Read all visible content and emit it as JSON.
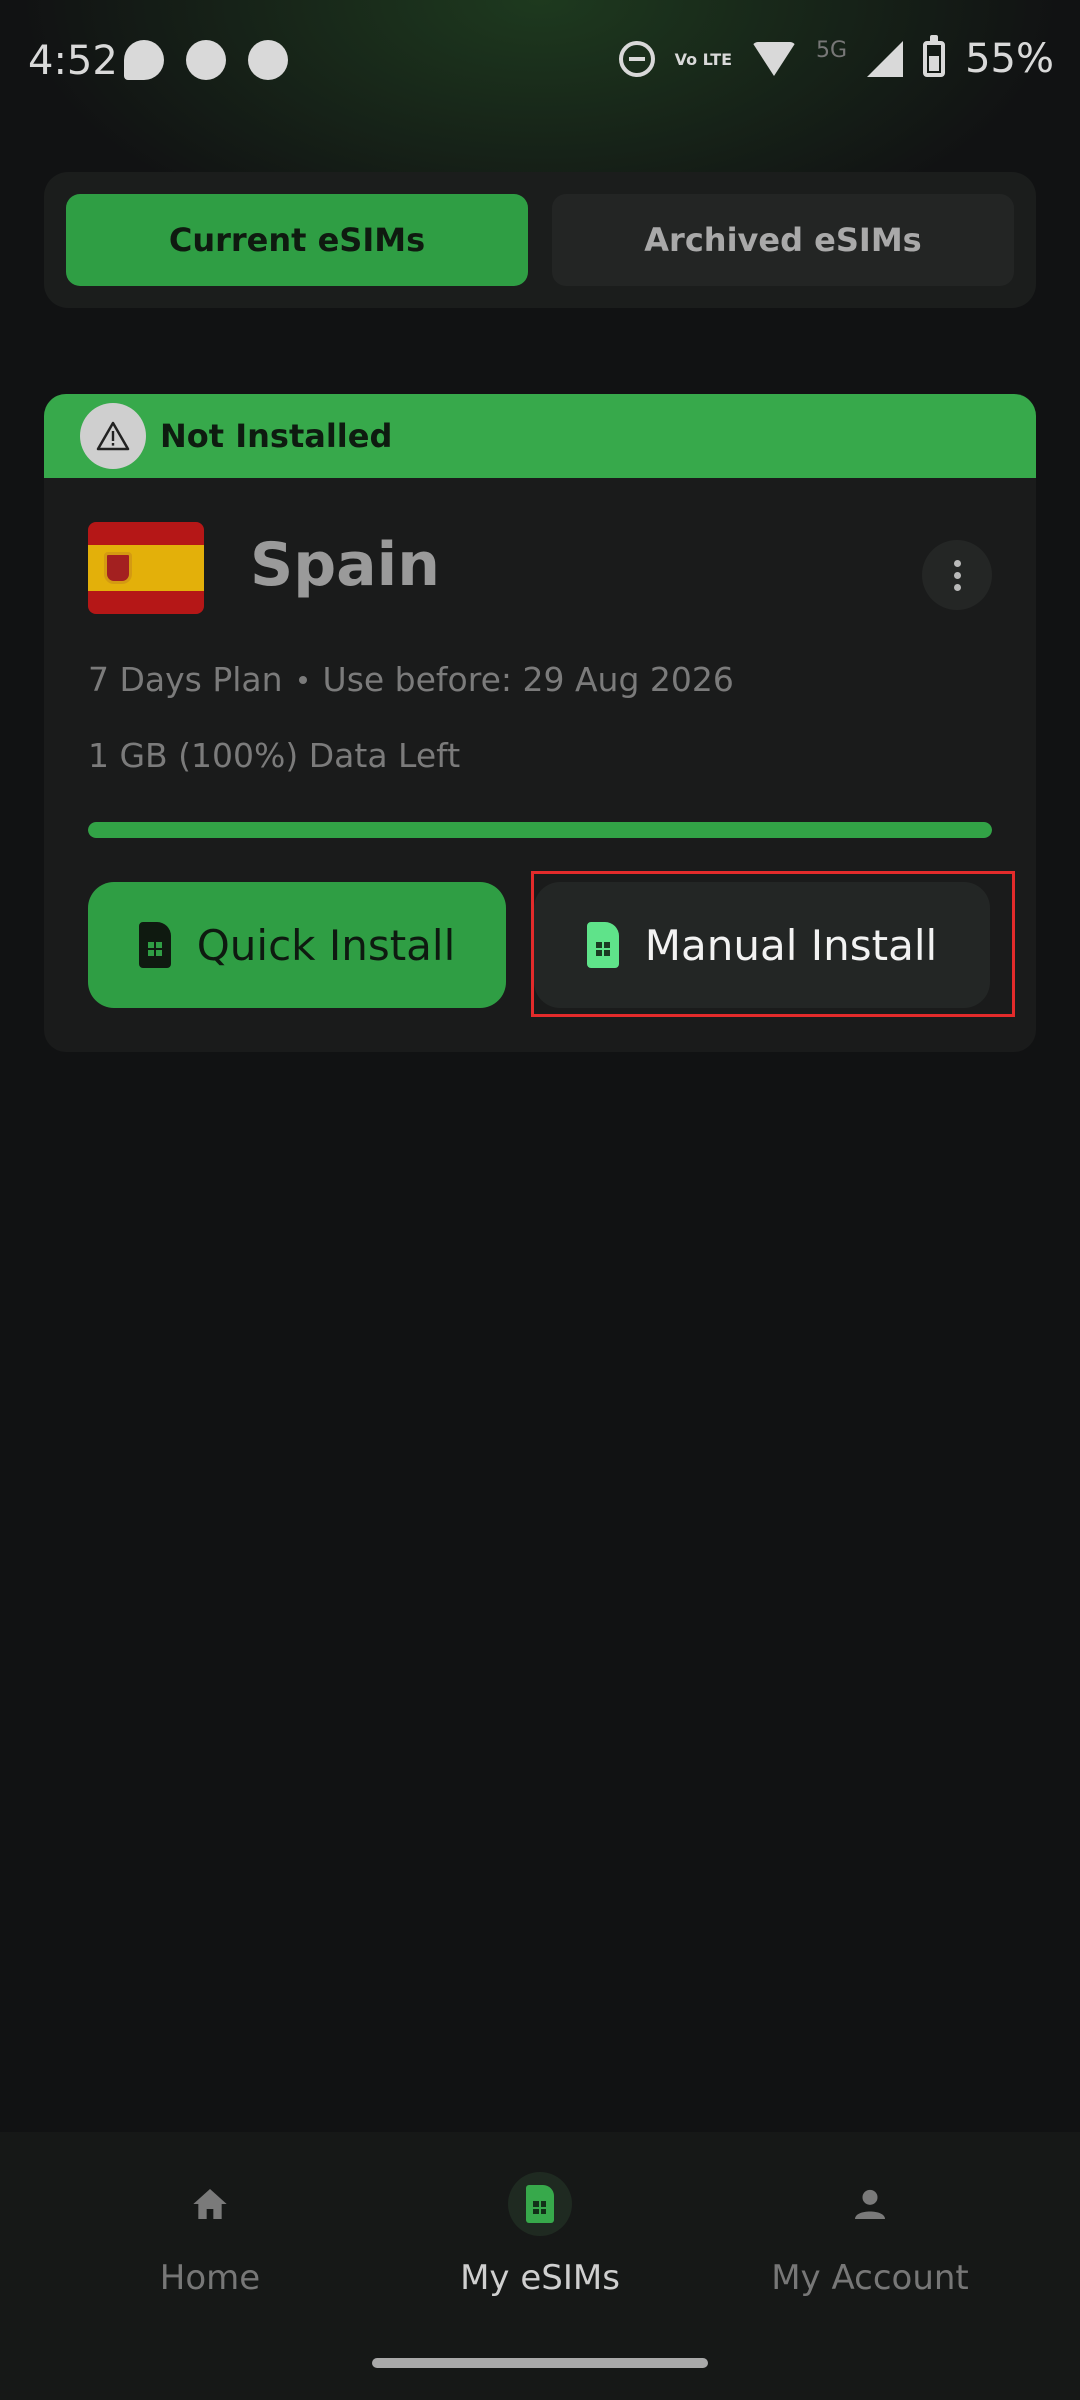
{
  "status_bar": {
    "time": "4:52",
    "network": "5G",
    "volte": "Vo LTE",
    "battery": "55%",
    "battery_level_pct": 55
  },
  "tabs": {
    "current": "Current eSIMs",
    "archived": "Archived eSIMs",
    "selected": "current"
  },
  "esim_card": {
    "status": "Not Installed",
    "country": "Spain",
    "plan": "7 Days Plan",
    "use_before": "Use before: 29 Aug 2026",
    "data_left": "1 GB (100%) Data Left",
    "data_remaining_pct": 100,
    "quick_install_label": "Quick Install",
    "manual_install_label": "Manual Install"
  },
  "bottom_nav": {
    "home": "Home",
    "my_esims": "My eSIMs",
    "my_account": "My Account",
    "active": "my_esims"
  },
  "colors": {
    "accent_green": "#2f9e44",
    "background": "#111213",
    "card": "#1a1b1b",
    "highlight": "#e32b2b"
  }
}
